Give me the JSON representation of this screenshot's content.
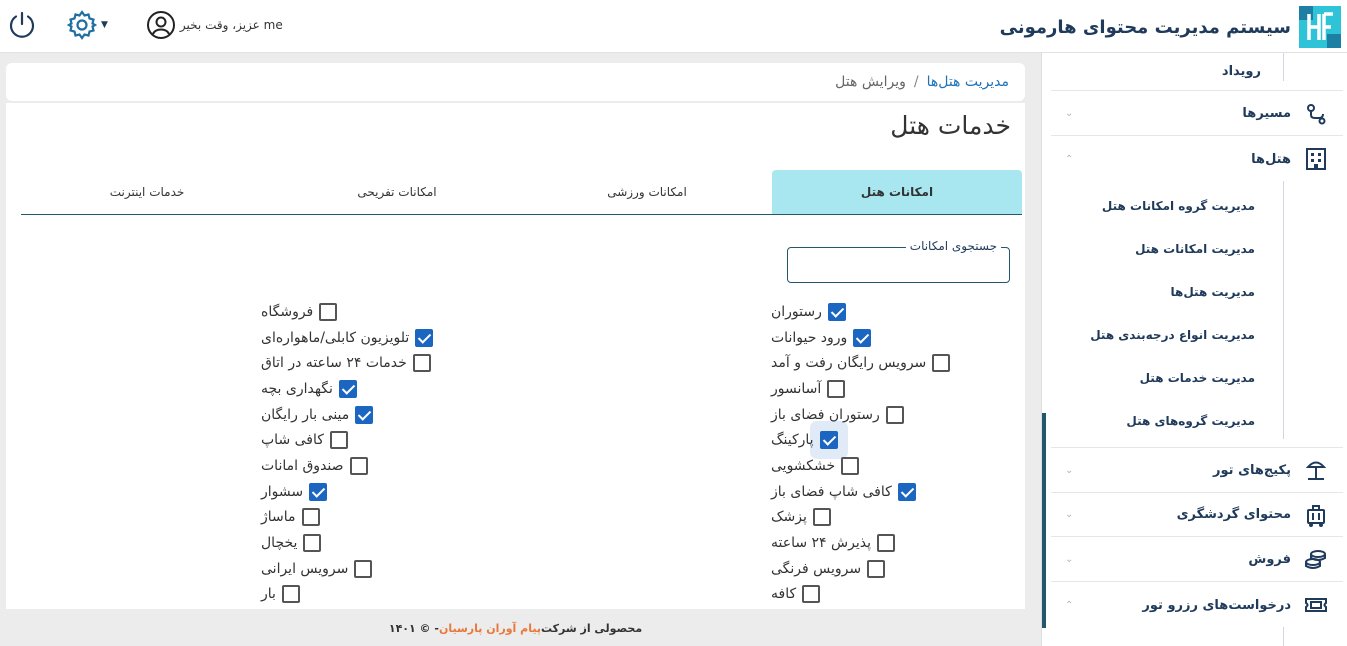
{
  "header": {
    "brand_title": "سیستم مدیریت محتوای هارمونی",
    "user_greeting": "me عزیز، وقت بخیر",
    "icons": {
      "logo": "harmony-logo-icon",
      "power": "power-icon",
      "settings": "gear-icon",
      "user": "user-circle-icon"
    }
  },
  "sidebar": {
    "items": [
      {
        "label": "رویداد"
      },
      {
        "label": "مسیرها",
        "icon": "route-icon"
      },
      {
        "label": "هتل‌ها",
        "icon": "building-icon"
      },
      {
        "label": "پکیج‌های تور",
        "icon": "beach-umbrella-icon"
      },
      {
        "label": "محتوای گردشگری",
        "icon": "luggage-icon"
      },
      {
        "label": "فروش",
        "icon": "coins-icon"
      },
      {
        "label": "درخواست‌های رزرو تور",
        "icon": "ticket-icon"
      }
    ],
    "hotel_sub_items": [
      "مدیریت گروه امکانات هتل",
      "مدیریت امکانات هتل",
      "مدیریت هتل‌ها",
      "مدیریت انواع درجه‌بندی هتل",
      "مدیریت خدمات هتل",
      "مدیریت گروه‌های هتل"
    ]
  },
  "breadcrumb": {
    "parent": "مدیریت هتل‌ها",
    "separator": "/",
    "current": "ویرایش هتل"
  },
  "page_title": "خدمات هتل",
  "tabs": [
    {
      "label": "امکانات هتل",
      "active": true
    },
    {
      "label": "امکانات ورزشی",
      "active": false
    },
    {
      "label": "امکانات تفریحی",
      "active": false
    },
    {
      "label": "خدمات اینترنت",
      "active": false
    }
  ],
  "search": {
    "label": "جستجوی امکانات",
    "value": ""
  },
  "amenities_right": [
    {
      "label": "رستوران",
      "checked": true
    },
    {
      "label": "ورود حیوانات",
      "checked": true
    },
    {
      "label": "سرویس رایگان رفت و آمد",
      "checked": false
    },
    {
      "label": "آسانسور",
      "checked": false
    },
    {
      "label": "رستوران فضای باز",
      "checked": false
    },
    {
      "label": "پارکینگ",
      "checked": true,
      "focused": true
    },
    {
      "label": "خشکشویی",
      "checked": false
    },
    {
      "label": "کافی شاپ فضای باز",
      "checked": true
    },
    {
      "label": "پزشک",
      "checked": false
    },
    {
      "label": "پذیرش ۲۴ ساعته",
      "checked": false
    },
    {
      "label": "سرویس فرنگی",
      "checked": false
    },
    {
      "label": "کافه",
      "checked": false
    }
  ],
  "amenities_left": [
    {
      "label": "فروشگاه",
      "checked": false
    },
    {
      "label": "تلویزیون کابلی/ماهواره‌ای",
      "checked": true
    },
    {
      "label": "خدمات ۲۴ ساعته در اتاق",
      "checked": false
    },
    {
      "label": "نگهداری بچه",
      "checked": true
    },
    {
      "label": "مینی بار رایگان",
      "checked": true
    },
    {
      "label": "کافی شاپ",
      "checked": false
    },
    {
      "label": "صندوق امانات",
      "checked": false
    },
    {
      "label": "سشوار",
      "checked": true
    },
    {
      "label": "ماساژ",
      "checked": false
    },
    {
      "label": "یخچال",
      "checked": false
    },
    {
      "label": "سرویس ایرانی",
      "checked": false
    },
    {
      "label": "بار",
      "checked": false
    }
  ],
  "footer": {
    "prefix": "محصولی از شرکت",
    "company": "پیام آوران پارسیان",
    "suffix": "- © ۱۴۰۱"
  },
  "colors": {
    "primary": "#24566e",
    "active_tab": "#a8e6f0",
    "checkbox": "#1a66c0",
    "link": "#1f72b8",
    "accent": "#e8783a"
  }
}
